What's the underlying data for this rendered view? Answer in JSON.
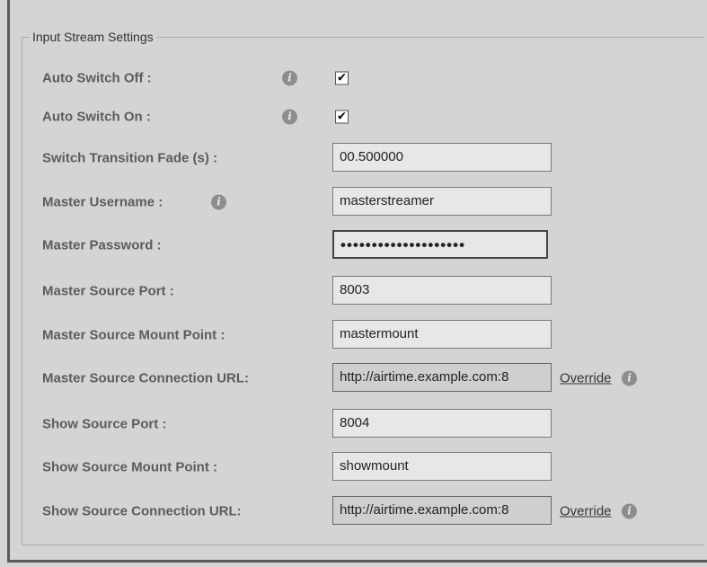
{
  "fieldset": {
    "legend": "Input Stream Settings"
  },
  "info_glyph": "i",
  "check_glyph": "✔",
  "rows": {
    "auto_switch_off": {
      "label": "Auto Switch Off :",
      "checked": true
    },
    "auto_switch_on": {
      "label": "Auto Switch On :",
      "checked": true
    },
    "switch_fade": {
      "label": "Switch Transition Fade (s) :",
      "value": "00.500000"
    },
    "master_username": {
      "label": "Master Username :",
      "value": "masterstreamer"
    },
    "master_password": {
      "label": "Master Password :",
      "value": "••••••••••••••••••••"
    },
    "master_port": {
      "label": "Master Source Port :",
      "value": "8003"
    },
    "master_mount": {
      "label": "Master Source Mount Point :",
      "value": "mastermount"
    },
    "master_url": {
      "label": "Master Source Connection URL:",
      "value": "http://airtime.example.com:8",
      "override_label": "Override"
    },
    "show_port": {
      "label": "Show Source Port :",
      "value": "8004"
    },
    "show_mount": {
      "label": "Show Source Mount Point :",
      "value": "showmount"
    },
    "show_url": {
      "label": "Show Source Connection URL:",
      "value": "http://airtime.example.com:8",
      "override_label": "Override"
    }
  },
  "colors": {
    "background": "#d4d4d4",
    "label": "#5c5c5c",
    "info_icon": "#8d8d8d",
    "input_bg": "#e7e7e7"
  }
}
